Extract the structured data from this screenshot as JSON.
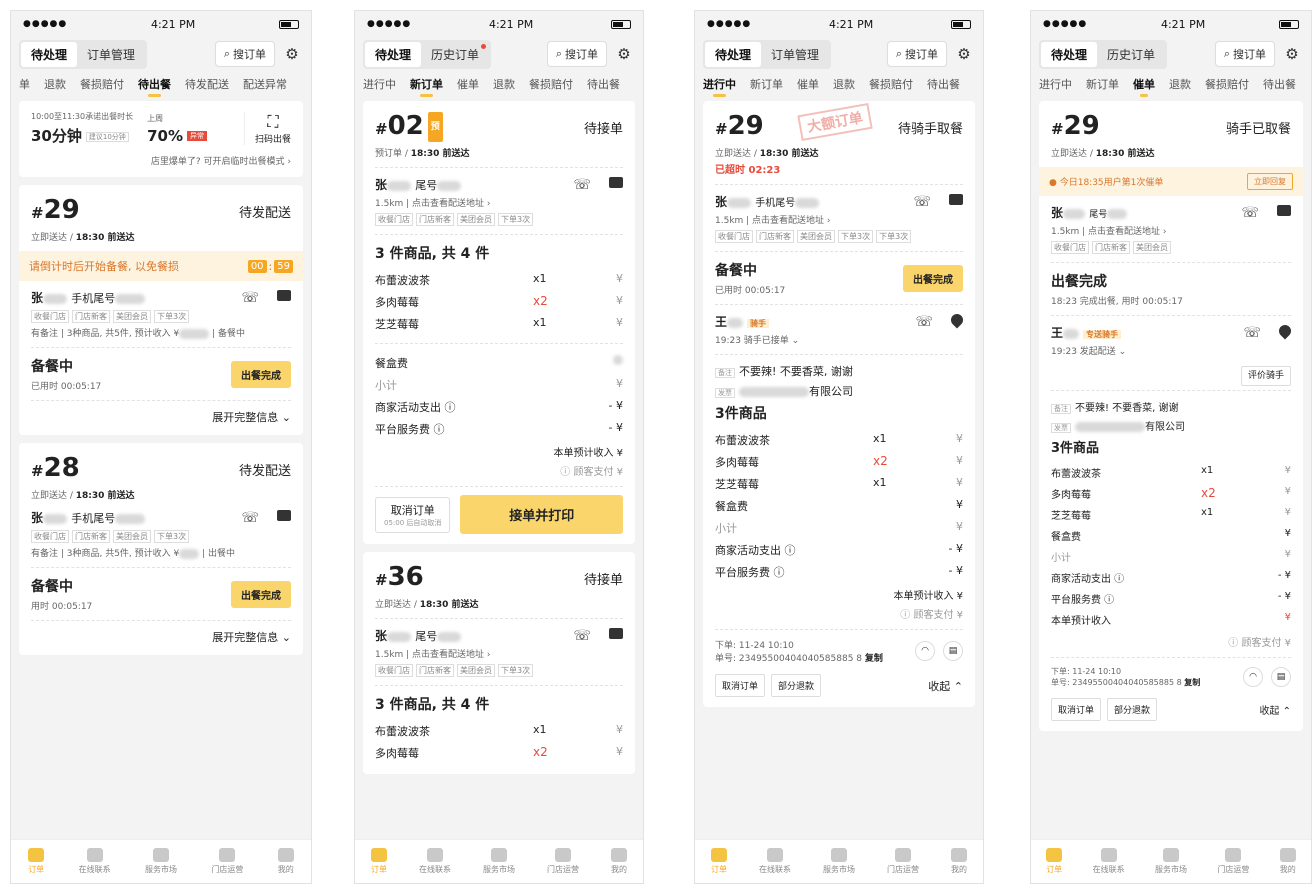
{
  "status_time": "4:21 PM",
  "nav": [
    "订单",
    "在线联系",
    "服务市场",
    "门店运营",
    "我的"
  ],
  "common": {
    "search": "搜订单",
    "single_btn": "单号",
    "copy": "复制"
  },
  "p1": {
    "seg": [
      "待处理",
      "订单管理"
    ],
    "tabs": [
      "单",
      "退款",
      "餐损赔付",
      "待出餐",
      "待发配送",
      "配送异常"
    ],
    "stats": {
      "label1": "10:00至11:30承诺出餐时长",
      "value1": "30分钟",
      "chip1": "建议10分钟",
      "label2": "上周",
      "value2": "70%",
      "chip2": "异常",
      "scan": "扫码出餐"
    },
    "hint": "店里爆单了? 可开启临时出餐模式 ›",
    "o1": {
      "no": "29",
      "status": "待发配送",
      "sub_a": "立即送达 / ",
      "sub_b": "18:30 前送达",
      "warn": "请倒计时后开始备餐, 以免餐损",
      "t1": "00",
      "t2": "59",
      "name": "张",
      "phone_label": "手机尾号",
      "badges": [
        "收餐门店",
        "门店新客",
        "美团会员",
        "下单3次"
      ],
      "note": "有备注 | 3种商品, 共5件, 预计收入 ¥",
      "note2": "| 备餐中",
      "prep": "备餐中",
      "elapsed": "已用时 00:05:17",
      "btn": "出餐完成",
      "expand": "展开完整信息 ⌄"
    },
    "o2": {
      "no": "28",
      "status": "待发配送",
      "sub_a": "立即送达 / ",
      "sub_b": "18:30 前送达",
      "name": "张",
      "phone_label": "手机尾号",
      "badges": [
        "收餐门店",
        "门店新客",
        "美团会员",
        "下单3次"
      ],
      "note": "有备注 | 3种商品, 共5件, 预计收入 ¥",
      "note2": "| 出餐中",
      "prep": "备餐中",
      "elapsed": "用时 00:05:17",
      "btn": "出餐完成",
      "expand": "展开完整信息 ⌄"
    }
  },
  "p2": {
    "seg": [
      "待处理",
      "历史订单"
    ],
    "tabs": [
      "进行中",
      "新订单",
      "催单",
      "退款",
      "餐损赔付",
      "待出餐"
    ],
    "o1": {
      "no": "02",
      "tag": "预",
      "status": "待接单",
      "sub_a": "预订单 / ",
      "sub_b": "18:30 前送达",
      "name": "张",
      "phone_label": "尾号",
      "dist": "1.5km | 点击查看配送地址 ›",
      "badges": [
        "收餐门店",
        "门店新客",
        "美团会员",
        "下单3次"
      ],
      "goods_title": "3 件商品, 共 4 件",
      "goods": [
        {
          "name": "布蕾波波茶",
          "qty": "x1",
          "price": "¥"
        },
        {
          "name": "多肉莓莓",
          "qty": "x2",
          "price": "¥"
        },
        {
          "name": "芝芝莓莓",
          "qty": "x1",
          "price": "¥"
        }
      ],
      "fee_box": "餐盒费",
      "subtotal": "小计",
      "activity": "商家活动支出 ⓘ",
      "service": "平台服务费 ⓘ",
      "income": "本单预计收入 ¥",
      "pay": "ⓘ 顾客支付 ¥",
      "minus": "- ¥",
      "yen": "¥",
      "cancel": "取消订单",
      "cancel_sub": "05:00 后自动取消",
      "accept": "接单并打印"
    },
    "o2": {
      "no": "36",
      "status": "待接单",
      "sub_a": "立即送达 / ",
      "sub_b": "18:30 前送达",
      "name": "张",
      "phone_label": "尾号",
      "dist": "1.5km | 点击查看配送地址 ›",
      "badges": [
        "收餐门店",
        "门店新客",
        "美团会员",
        "下单3次"
      ],
      "goods_title": "3 件商品, 共 4 件",
      "goods": [
        {
          "name": "布蕾波波茶",
          "qty": "x1",
          "price": "¥"
        },
        {
          "name": "多肉莓莓",
          "qty": "x2",
          "price": "¥"
        }
      ]
    }
  },
  "p3": {
    "seg": [
      "待处理",
      "订单管理"
    ],
    "tabs": [
      "进行中",
      "新订单",
      "催单",
      "退款",
      "餐损赔付",
      "待出餐"
    ],
    "o1": {
      "no": "29",
      "stamp": "大额订单",
      "status": "待骑手取餐",
      "sub_a": "立即送达 / ",
      "sub_b": "18:30 前送达",
      "overtime": "已超时 02:23",
      "name": "张",
      "phone_label": "手机尾号",
      "dist": "1.5km | 点击查看配送地址 ›",
      "badges": [
        "收餐门店",
        "门店新客",
        "美团会员",
        "下单3次",
        "下单3次"
      ],
      "prep": "备餐中",
      "elapsed": "已用时 00:05:17",
      "btn": "出餐完成",
      "rider": "王",
      "rider_tag": "骑手",
      "rider_time": "19:23 骑手已接单 ⌄",
      "note_tag": "备注",
      "note": "不要辣! 不要香菜, 谢谢",
      "invoice_tag": "发票",
      "invoice": "有限公司",
      "goods_title": "3件商品",
      "goods": [
        {
          "name": "布蕾波波茶",
          "qty": "x1",
          "price": "¥"
        },
        {
          "name": "多肉莓莓",
          "qty": "x2",
          "price": "¥"
        },
        {
          "name": "芝芝莓莓",
          "qty": "x1",
          "price": "¥"
        }
      ],
      "fee_box": "餐盒费",
      "subtotal": "小计",
      "activity": "商家活动支出 ⓘ",
      "service": "平台服务费 ⓘ",
      "income": "本单预计收入 ¥",
      "pay": "ⓘ 顾客支付 ¥",
      "minus": "- ¥",
      "yen": "¥",
      "order_time": "下单: 11-24 10:10",
      "order_id": "单号: 23495500404040585885 8",
      "cancel": "取消订单",
      "refund": "部分退款",
      "collapse": "收起 ⌃"
    }
  },
  "p4": {
    "seg": [
      "待处理",
      "历史订单"
    ],
    "tabs": [
      "进行中",
      "新订单",
      "催单",
      "退款",
      "餐损赔付",
      "待出餐"
    ],
    "o1": {
      "no": "29",
      "status": "骑手已取餐",
      "sub_a": "立即送达 / ",
      "sub_b": "18:30 前送达",
      "remind": "● 今日18:35用户第1次催单",
      "remind_btn": "立即回复",
      "name": "张",
      "phone_label": "尾号",
      "dist": "1.5km | 点击查看配送地址 ›",
      "badges": [
        "收餐门店",
        "门店新客",
        "美团会员"
      ],
      "done": "出餐完成",
      "done_sub": "18:23 完成出餐, 用时 00:05:17",
      "rider": "王",
      "rider_tag": "专送骑手",
      "rider_time": "19:23 发起配送 ⌄",
      "rate": "评价骑手",
      "note_tag": "备注",
      "note": "不要辣! 不要香菜, 谢谢",
      "invoice_tag": "发票",
      "invoice": "有限公司",
      "goods_title": "3件商品",
      "goods": [
        {
          "name": "布蕾波波茶",
          "qty": "x1",
          "price": "¥"
        },
        {
          "name": "多肉莓莓",
          "qty": "x2",
          "price": "¥"
        },
        {
          "name": "芝芝莓莓",
          "qty": "x1",
          "price": "¥"
        }
      ],
      "fee_box": "餐盒费",
      "subtotal": "小计",
      "activity": "商家活动支出 ⓘ",
      "service": "平台服务费 ⓘ",
      "income_label": "本单预计收入",
      "pay": "ⓘ 顾客支付 ¥",
      "minus": "- ¥",
      "yen": "¥",
      "order_time": "下单: 11-24 10:10",
      "order_id": "单号: 23495500404040585885 8",
      "cancel": "取消订单",
      "refund": "部分退款",
      "collapse": "收起 ⌃"
    }
  },
  "colors": {
    "accent": "#f5c342",
    "warn": "#d9772b",
    "danger": "#e84a3a"
  }
}
